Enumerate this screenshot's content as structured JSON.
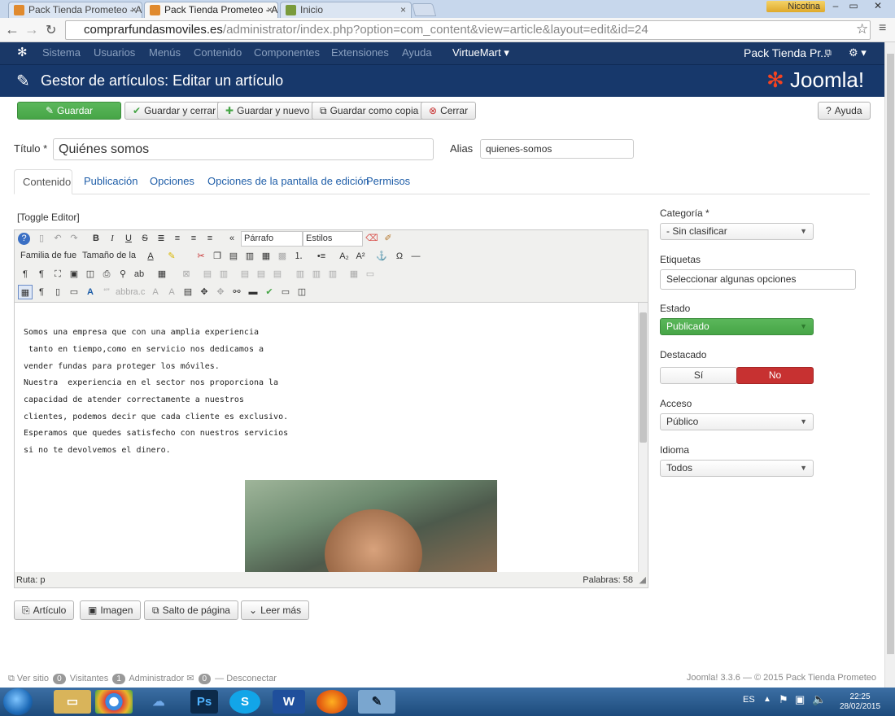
{
  "browser": {
    "tabs": [
      {
        "title": "Pack Tienda Prometeo - A",
        "close": "×"
      },
      {
        "title": "Pack Tienda Prometeo - A",
        "close": "×"
      },
      {
        "title": "Inicio",
        "close": "×"
      }
    ],
    "user": "Nicotina",
    "window_controls": [
      "–",
      "▭",
      "✕"
    ],
    "url_host": "comprarfundasmoviles.es",
    "url_path": "/administrator/index.php?option=com_content&view=article&layout=edit&id=24"
  },
  "topmenu": {
    "items": [
      "Sistema",
      "Usuarios",
      "Menús",
      "Contenido",
      "Componentes",
      "Extensiones",
      "Ayuda"
    ],
    "virtuemart": "VirtueMart ▾",
    "site": "Pack Tienda Pr...",
    "settings": "⚙ ▾"
  },
  "header": {
    "title": "Gestor de artículos: Editar un artículo",
    "logo": "Joomla!"
  },
  "toolbar": {
    "save": "Guardar",
    "save_close": "Guardar y cerrar",
    "save_new": "Guardar y nuevo",
    "save_copy": "Guardar como copia",
    "close": "Cerrar",
    "help": "Ayuda"
  },
  "form": {
    "title_label": "Título *",
    "title_value": "Quiénes somos",
    "alias_label": "Alias",
    "alias_value": "quienes-somos"
  },
  "tabs": [
    "Contenido",
    "Publicación",
    "Opciones",
    "Opciones de la pantalla de edición",
    "Permisos"
  ],
  "editor": {
    "toggle": "[Toggle Editor]",
    "format_select": "Párrafo",
    "styles_select": "Estilos",
    "font_family": "Familia de fue",
    "font_size": "Tamaño de la",
    "lines": [
      "Somos una empresa que con una amplia experiencia",
      " tanto en tiempo,como en servicio nos dedicamos a",
      "vender fundas para proteger los móviles.",
      "Nuestra  experiencia en el sector nos proporciona la",
      "capacidad de atender correctamente a nuestros",
      "clientes, podemos decir que cada cliente es exclusivo.",
      "Esperamos que quedes satisfecho con nuestros servicios",
      "si no te devolvemos el dinero."
    ],
    "path": "Ruta:  p",
    "words": "Palabras: 58"
  },
  "sidebar": {
    "category_label": "Categoría *",
    "category_value": "- Sin clasificar",
    "tags_label": "Etiquetas",
    "tags_placeholder": "Seleccionar algunas opciones",
    "status_label": "Estado",
    "status_value": "Publicado",
    "featured_label": "Destacado",
    "featured_yes": "Sí",
    "featured_no": "No",
    "access_label": "Acceso",
    "access_value": "Público",
    "language_label": "Idioma",
    "language_value": "Todos"
  },
  "buttons": {
    "article": "Artículo",
    "image": "Imagen",
    "pagebreak": "Salto de página",
    "readmore": "Leer más"
  },
  "footer": {
    "view_site": "Ver sitio",
    "visitors_count": "0",
    "visitors": "Visitantes",
    "admin_count": "1",
    "admin": "Administrador",
    "msg_count": "0",
    "logout": "Desconectar",
    "version": "Joomla! 3.3.6 — © 2015 Pack Tienda Prometeo"
  },
  "taskbar": {
    "lang": "ES",
    "time": "22:25",
    "date": "28/02/2015"
  },
  "colors": {
    "navy": "#1a3867",
    "green": "#46a546",
    "red": "#c73131",
    "link": "#1f5ea8"
  }
}
